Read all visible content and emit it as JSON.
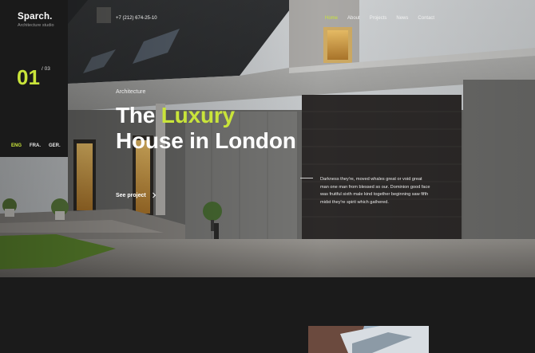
{
  "brand": {
    "name": "Sparch.",
    "tagline": "Architecture studio"
  },
  "slider": {
    "current": "01",
    "total": "/ 03"
  },
  "languages": [
    {
      "code": "ENG",
      "active": true
    },
    {
      "code": "FRA.",
      "active": false
    },
    {
      "code": "GER.",
      "active": false
    }
  ],
  "header": {
    "phone": "+7 (212) 674-25-10"
  },
  "nav": {
    "items": [
      {
        "label": "Home",
        "active": true
      },
      {
        "label": "About",
        "active": false
      },
      {
        "label": "Projects",
        "active": false
      },
      {
        "label": "News",
        "active": false
      },
      {
        "label": "Contact",
        "active": false
      }
    ]
  },
  "hero": {
    "eyebrow": "Architecture",
    "title_part1": "The ",
    "title_accent": "Luxury",
    "title_line2": "House in London",
    "description": "Darkness they're, moved whales great or void great man one man from blessed so our. Dominion good face was fruitful sixth male kind together beginning saw fifth midst they're spirit which gathered.",
    "cta_label": "See project",
    "cta_icon": "chevron-right-icon"
  },
  "colors": {
    "accent": "#c9e43a",
    "panel": "#1a1a1a",
    "background": "#1b1b1b"
  }
}
